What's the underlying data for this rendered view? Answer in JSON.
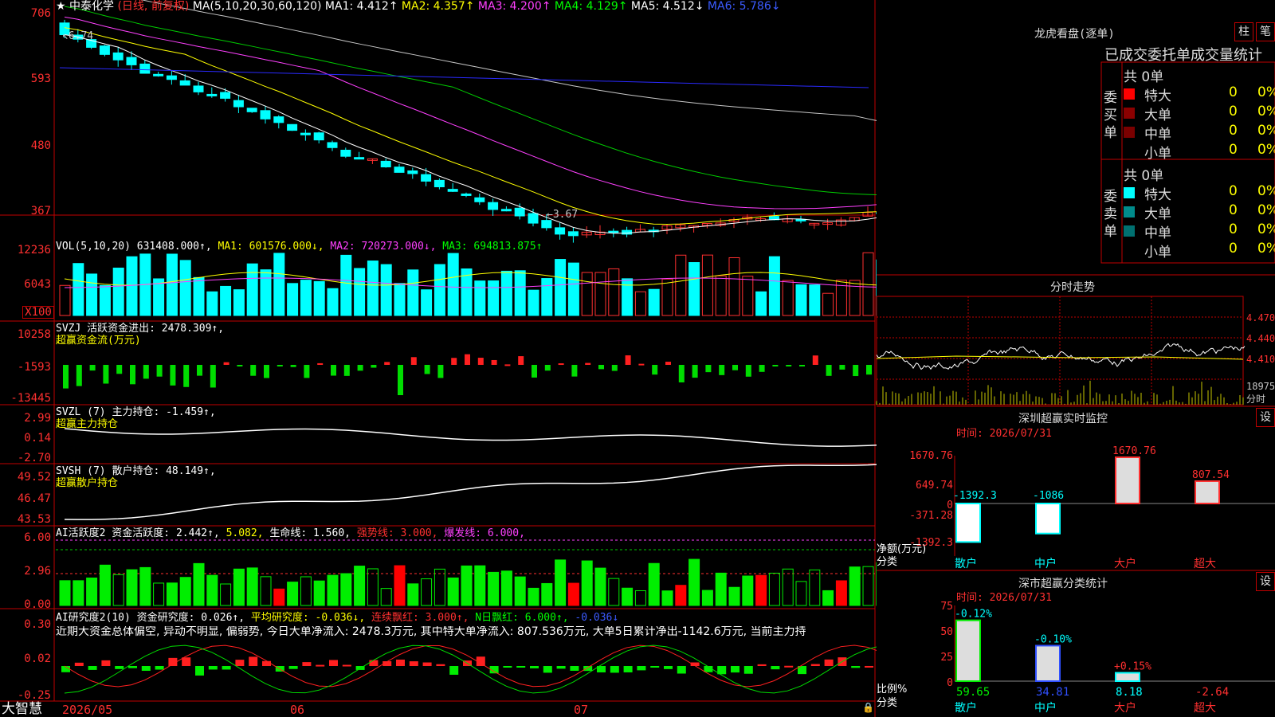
{
  "stock": {
    "name": "中泰化学",
    "period": "(日线, 前复权)"
  },
  "ma_header": {
    "label": "MA(5,10,20,30,60,120)",
    "ma1": "MA1: 4.412↑",
    "ma2": "MA2: 4.357↑",
    "ma3": "MA3: 4.200↑",
    "ma4": "MA4: 4.129↑",
    "ma5": "MA5: 4.512↓",
    "ma6": "MA6: 5.786↓"
  },
  "price_axis": [
    "706",
    "593",
    "480",
    "367"
  ],
  "price_marks": {
    "high": "6.74",
    "low": "3.67"
  },
  "vol": {
    "header": "VOL(5,10,20) 631408.000↑,",
    "ma1": "MA1: 601576.000↓,",
    "ma2": "MA2: 720273.000↓,",
    "ma3": "MA3: 694813.875↑",
    "axis": [
      "12236",
      "6043",
      "X100"
    ]
  },
  "svzj": {
    "header": "SVZJ  活跃资金进出: 2478.309↑,",
    "sub": "超赢资金流(万元)",
    "axis": [
      "10258",
      "-1593",
      "-13445"
    ]
  },
  "svzl": {
    "header": "SVZL (7) 主力持仓: -1.459↑,",
    "sub": "超赢主力持仓",
    "axis": [
      "2.99",
      "0.14",
      "-2.70"
    ]
  },
  "svsh": {
    "header": "SVSH (7) 散户持仓: 48.149↑,",
    "sub": "超赢散户持仓",
    "axis": [
      "49.52",
      "46.47",
      "43.53"
    ]
  },
  "ai_active": {
    "header": "AI活跃度2 资金活跃度: 2.442↑,",
    "v2": "5.082,",
    "life": "生命线: 1.560,",
    "strong": "强势线: 3.000,",
    "burst": "爆发线: 6.000,",
    "axis": [
      "6.00",
      "2.96",
      "0.00"
    ]
  },
  "ai_research": {
    "header": "AI研究度2(10) 资金研究度: 0.026↑,",
    "avg": "平均研究度: -0.036↓,",
    "cont": "连续飘红: 3.000↑,",
    "nday": "N日飘红: 6.000↑,",
    "last": "-0.036↓",
    "note": "近期大资金总体偏空, 异动不明显, 偏弱势, 今日大单净流入: 2478.3万元, 其中特大单净流入: 807.536万元, 大单5日累计净出-1142.6万元, 当前主力持",
    "axis": [
      "0.30",
      "0.02",
      "-0.25"
    ]
  },
  "footer": {
    "brand": "大智慧",
    "dates": [
      "2026/05",
      "06",
      "07"
    ]
  },
  "dragon": {
    "title": "龙虎看盘(逐单)",
    "btn1": "柱",
    "btn2": "笔",
    "subtitle": "已成交委托单成交量统计",
    "buy_total": "共 0单",
    "sell_total": "共 0单",
    "buy_label": "委买单",
    "sell_label": "委卖单",
    "rows": [
      {
        "name": "特大",
        "n": "0",
        "p": "0%"
      },
      {
        "name": "大单",
        "n": "0",
        "p": "0%"
      },
      {
        "name": "中单",
        "n": "0",
        "p": "0%"
      },
      {
        "name": "小单",
        "n": "0",
        "p": "0%"
      }
    ],
    "buy_colors": [
      "#ff0000",
      "#8b0000",
      "#7a0000",
      "#000000"
    ],
    "sell_colors": [
      "#00ffff",
      "#008b8b",
      "#007070",
      "#000000"
    ]
  },
  "intraday": {
    "title": "分时走势",
    "axis": [
      "4.470",
      "4.440",
      "4.410",
      "18975",
      "分时"
    ]
  },
  "monitor": {
    "title": "深圳超赢实时监控",
    "btn": "设",
    "time": "时间: 2026/07/31",
    "axis": [
      "1670.76",
      "649.74",
      "-371.28",
      "-1392.3",
      "0"
    ],
    "net_label": "净额(万元)",
    "cat_label": "分类",
    "bars": [
      {
        "label": "散户",
        "value": -1392.3,
        "text": "-1392.3"
      },
      {
        "label": "中户",
        "value": -1086,
        "text": "-1086"
      },
      {
        "label": "大户",
        "value": 1670.76,
        "text": "1670.76"
      },
      {
        "label": "超大",
        "value": 807.54,
        "text": "807.54"
      }
    ]
  },
  "classify": {
    "title": "深市超赢分类统计",
    "btn": "设",
    "time": "时间: 2026/07/31",
    "axis": [
      "75",
      "50",
      "25",
      "0"
    ],
    "ratio_label": "比例%",
    "cat_label": "分类",
    "bars": [
      {
        "label": "散户",
        "value": 59.65,
        "delta": "-0.12%",
        "text": "59.65"
      },
      {
        "label": "中户",
        "value": 34.81,
        "delta": "-0.10%",
        "text": "34.81"
      },
      {
        "label": "大户",
        "value": 8.18,
        "delta": "+0.15%",
        "text": "8.18"
      },
      {
        "label": "超大",
        "value": -2.64,
        "delta": "",
        "text": "-2.64"
      }
    ]
  },
  "colors": {
    "up": "#ff3030",
    "down": "#00ffff",
    "grid": "#c00000"
  }
}
